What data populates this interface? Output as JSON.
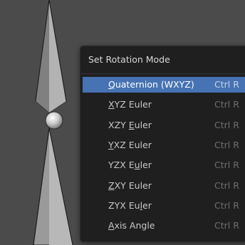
{
  "menu": {
    "title": "Set Rotation Mode",
    "items": [
      {
        "pre": "",
        "u": "Q",
        "post": "uaternion (WXYZ)",
        "shortcut": "Ctrl R",
        "active": true
      },
      {
        "pre": "",
        "u": "X",
        "post": "YZ Euler",
        "shortcut": "Ctrl R",
        "active": false
      },
      {
        "pre": "XZY ",
        "u": "E",
        "post": "uler",
        "shortcut": "Ctrl R",
        "active": false
      },
      {
        "pre": "",
        "u": "Y",
        "post": "XZ Euler",
        "shortcut": "Ctrl R",
        "active": false
      },
      {
        "pre": "YZX E",
        "u": "u",
        "post": "ler",
        "shortcut": "Ctrl R",
        "active": false
      },
      {
        "pre": "",
        "u": "Z",
        "post": "XY Euler",
        "shortcut": "Ctrl R",
        "active": false
      },
      {
        "pre": "ZYX Eu",
        "u": "l",
        "post": "er",
        "shortcut": "Ctrl R",
        "active": false
      },
      {
        "pre": "",
        "u": "A",
        "post": "xis Angle",
        "shortcut": "Ctrl R",
        "active": false
      }
    ]
  },
  "colors": {
    "viewport_bg": "#4b4b4b",
    "menu_bg": "#1f1f1f",
    "highlight": "#4772b3"
  },
  "icons": [
    "bone-shape",
    "bone-joint-sphere"
  ]
}
